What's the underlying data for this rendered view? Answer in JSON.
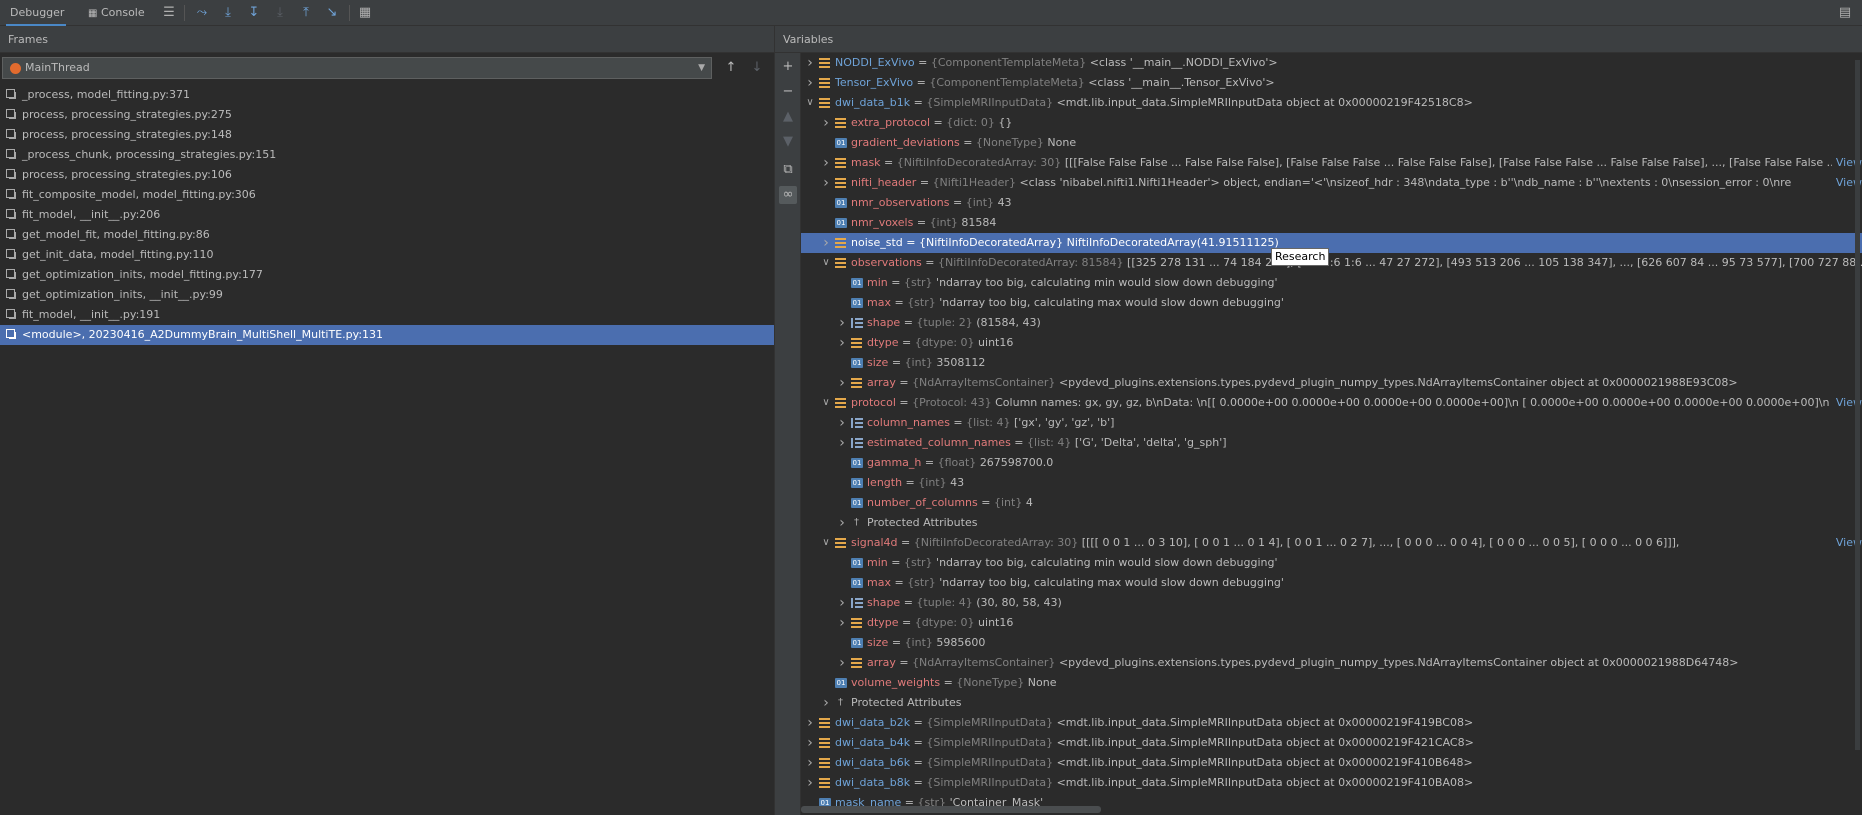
{
  "toolbar": {
    "debugger_tab": "Debugger",
    "console_tab": "Console",
    "buttons": [
      "menu-icon",
      "step-over-icon",
      "step-into-icon",
      "step-into-my-code-icon",
      "force-step-into-icon",
      "step-out-icon",
      "run-to-cursor-icon",
      "evaluate-table-icon"
    ]
  },
  "frames_panel": {
    "title": "Frames",
    "thread": "MainThread",
    "frames": [
      "_process, model_fitting.py:371",
      "process, processing_strategies.py:275",
      "process, processing_strategies.py:148",
      "_process_chunk, processing_strategies.py:151",
      "process, processing_strategies.py:106",
      "fit_composite_model, model_fitting.py:306",
      "fit_model, __init__.py:206",
      "get_model_fit, model_fitting.py:86",
      "get_init_data, model_fitting.py:110",
      "get_optimization_inits, model_fitting.py:177",
      "get_optimization_inits, __init__.py:99",
      "fit_model, __init__.py:191",
      "<module>, 20230416_A2DummyBrain_MultiShell_MultiTE.py:131"
    ],
    "selected_index": 12
  },
  "variables_panel": {
    "title": "Variables",
    "tooltip": "Research",
    "view_link": "View",
    "rows": [
      {
        "depth": 0,
        "arrow": "collapsed",
        "icon": "obj",
        "name": "NODDI_ExVivo",
        "style": "blue",
        "type": "{ComponentTemplateMeta}",
        "value": "<class '__main__.NODDI_ExVivo'>"
      },
      {
        "depth": 0,
        "arrow": "collapsed",
        "icon": "obj",
        "name": "Tensor_ExVivo",
        "style": "blue",
        "type": "{ComponentTemplateMeta}",
        "value": "<class '__main__.Tensor_ExVivo'>"
      },
      {
        "depth": 0,
        "arrow": "expanded",
        "icon": "obj",
        "name": "dwi_data_b1k",
        "style": "blue",
        "type": "{SimpleMRIInputData}",
        "value": "<mdt.lib.input_data.SimpleMRIInputData object at 0x00000219F42518C8>"
      },
      {
        "depth": 1,
        "arrow": "collapsed",
        "icon": "obj",
        "name": "extra_protocol",
        "style": "red",
        "type": "{dict: 0}",
        "value": "{}"
      },
      {
        "depth": 1,
        "arrow": "none",
        "icon": "01",
        "name": "gradient_deviations",
        "style": "red",
        "type": "{NoneType}",
        "value": "None"
      },
      {
        "depth": 1,
        "arrow": "collapsed",
        "icon": "obj",
        "name": "mask",
        "style": "red",
        "type": "{NiftiInfoDecoratedArray: 30}",
        "value": "[[[False False False ... False False False],  [False False False ... False False False],  [False False False ... False False False],  ...,  [False False False ... False Fal",
        "view": true
      },
      {
        "depth": 1,
        "arrow": "collapsed",
        "icon": "obj",
        "name": "nifti_header",
        "style": "red",
        "type": "{Nifti1Header}",
        "value": "<class 'nibabel.nifti1.Nifti1Header'> object, endian='<'\\nsizeof_hdr     : 348\\ndata_type      : b''\\ndb_name        : b''\\nextents        : 0\\nsession_error  : 0\\nre",
        "view": true
      },
      {
        "depth": 1,
        "arrow": "none",
        "icon": "01",
        "name": "nmr_observations",
        "style": "red",
        "type": "{int}",
        "value": "43"
      },
      {
        "depth": 1,
        "arrow": "none",
        "icon": "01",
        "name": "nmr_voxels",
        "style": "red",
        "type": "{int}",
        "value": "81584"
      },
      {
        "depth": 1,
        "arrow": "collapsed",
        "icon": "obj",
        "name": "noise_std",
        "style": "red",
        "type": "{NiftiInfoDecoratedArray}",
        "value": "NiftiInfoDecoratedArray(41.91511125)",
        "selected": true
      },
      {
        "depth": 1,
        "arrow": "expanded",
        "icon": "obj",
        "name": "observations",
        "style": "red",
        "type": "{NiftiInfoDecoratedArray: 81584}",
        "value": "[[325 278 131 ...  74 184 283], [2:6 2:6 1:6 ...  47  27 272], [493 513 206 ... 105 138 347], ..., [626 607  84 ...  95  73 577], [700 727  88 ...  88  48 685], [6",
        "view": false
      },
      {
        "depth": 2,
        "arrow": "none",
        "icon": "01",
        "name": "min",
        "style": "red",
        "type": "{str}",
        "value": "'ndarray too big, calculating min would slow down debugging'"
      },
      {
        "depth": 2,
        "arrow": "none",
        "icon": "01",
        "name": "max",
        "style": "red",
        "type": "{str}",
        "value": "'ndarray too big, calculating max would slow down debugging'"
      },
      {
        "depth": 2,
        "arrow": "collapsed",
        "icon": "list",
        "name": "shape",
        "style": "red",
        "type": "{tuple: 2}",
        "value": "(81584, 43)"
      },
      {
        "depth": 2,
        "arrow": "collapsed",
        "icon": "obj",
        "name": "dtype",
        "style": "red",
        "type": "{dtype: 0}",
        "value": "uint16"
      },
      {
        "depth": 2,
        "arrow": "none",
        "icon": "01",
        "name": "size",
        "style": "red",
        "type": "{int}",
        "value": "3508112"
      },
      {
        "depth": 2,
        "arrow": "collapsed",
        "icon": "obj",
        "name": "array",
        "style": "red",
        "type": "{NdArrayItemsContainer}",
        "value": "<pydevd_plugins.extensions.types.pydevd_plugin_numpy_types.NdArrayItemsContainer object at 0x0000021988E93C08>"
      },
      {
        "depth": 1,
        "arrow": "expanded",
        "icon": "obj",
        "name": "protocol",
        "style": "red",
        "type": "{Protocol: 43}",
        "value": "Column names: gx, gy, gz, b\\nData: \\n[[ 0.0000e+00  0.0000e+00  0.0000e+00  0.0000e+00]\\n [ 0.0000e+00  0.0000e+00  0.0000e+00  0.0000e+00]\\n [ 9.1906e-01 -...",
        "view": true
      },
      {
        "depth": 2,
        "arrow": "collapsed",
        "icon": "list",
        "name": "column_names",
        "style": "red",
        "type": "{list: 4}",
        "value": "['gx', 'gy', 'gz', 'b']"
      },
      {
        "depth": 2,
        "arrow": "collapsed",
        "icon": "list",
        "name": "estimated_column_names",
        "style": "red",
        "type": "{list: 4}",
        "value": "['G', 'Delta', 'delta', 'g_sph']"
      },
      {
        "depth": 2,
        "arrow": "none",
        "icon": "01",
        "name": "gamma_h",
        "style": "red",
        "type": "{float}",
        "value": "267598700.0"
      },
      {
        "depth": 2,
        "arrow": "none",
        "icon": "01",
        "name": "length",
        "style": "red",
        "type": "{int}",
        "value": "43"
      },
      {
        "depth": 2,
        "arrow": "none",
        "icon": "01",
        "name": "number_of_columns",
        "style": "red",
        "type": "{int}",
        "value": "4"
      },
      {
        "depth": 2,
        "arrow": "collapsed",
        "icon": "prot",
        "name": "Protected Attributes",
        "style": "plain",
        "type": "",
        "value": ""
      },
      {
        "depth": 1,
        "arrow": "expanded",
        "icon": "obj",
        "name": "signal4d",
        "style": "red",
        "type": "{NiftiInfoDecoratedArray: 30}",
        "value": "[[[[  0   0   1 ...   0   3  10],   [  0   0   1 ...   0   1   4],   [  0   0   1 ...   0   2   7],   ...,   [  0   0   0 ...   0   0   4],   [  0   0   0 ...   0   0   5],   [  0   0   0 ...   0   0   6]]],",
        "view": true
      },
      {
        "depth": 2,
        "arrow": "none",
        "icon": "01",
        "name": "min",
        "style": "red",
        "type": "{str}",
        "value": "'ndarray too big, calculating min would slow down debugging'"
      },
      {
        "depth": 2,
        "arrow": "none",
        "icon": "01",
        "name": "max",
        "style": "red",
        "type": "{str}",
        "value": "'ndarray too big, calculating max would slow down debugging'"
      },
      {
        "depth": 2,
        "arrow": "collapsed",
        "icon": "list",
        "name": "shape",
        "style": "red",
        "type": "{tuple: 4}",
        "value": "(30, 80, 58, 43)"
      },
      {
        "depth": 2,
        "arrow": "collapsed",
        "icon": "obj",
        "name": "dtype",
        "style": "red",
        "type": "{dtype: 0}",
        "value": "uint16"
      },
      {
        "depth": 2,
        "arrow": "none",
        "icon": "01",
        "name": "size",
        "style": "red",
        "type": "{int}",
        "value": "5985600"
      },
      {
        "depth": 2,
        "arrow": "collapsed",
        "icon": "obj",
        "name": "array",
        "style": "red",
        "type": "{NdArrayItemsContainer}",
        "value": "<pydevd_plugins.extensions.types.pydevd_plugin_numpy_types.NdArrayItemsContainer object at 0x0000021988D64748>"
      },
      {
        "depth": 1,
        "arrow": "none",
        "icon": "01",
        "name": "volume_weights",
        "style": "red",
        "type": "{NoneType}",
        "value": "None"
      },
      {
        "depth": 1,
        "arrow": "collapsed",
        "icon": "prot",
        "name": "Protected Attributes",
        "style": "plain",
        "type": "",
        "value": ""
      },
      {
        "depth": 0,
        "arrow": "collapsed",
        "icon": "obj",
        "name": "dwi_data_b2k",
        "style": "blue",
        "type": "{SimpleMRIInputData}",
        "value": "<mdt.lib.input_data.SimpleMRIInputData object at 0x00000219F419BC08>"
      },
      {
        "depth": 0,
        "arrow": "collapsed",
        "icon": "obj",
        "name": "dwi_data_b4k",
        "style": "blue",
        "type": "{SimpleMRIInputData}",
        "value": "<mdt.lib.input_data.SimpleMRIInputData object at 0x00000219F421CAC8>"
      },
      {
        "depth": 0,
        "arrow": "collapsed",
        "icon": "obj",
        "name": "dwi_data_b6k",
        "style": "blue",
        "type": "{SimpleMRIInputData}",
        "value": "<mdt.lib.input_data.SimpleMRIInputData object at 0x00000219F410B648>"
      },
      {
        "depth": 0,
        "arrow": "collapsed",
        "icon": "obj",
        "name": "dwi_data_b8k",
        "style": "blue",
        "type": "{SimpleMRIInputData}",
        "value": "<mdt.lib.input_data.SimpleMRIInputData object at 0x00000219F410BA08>"
      },
      {
        "depth": 0,
        "arrow": "none",
        "icon": "01",
        "name": "mask_name",
        "style": "blue",
        "type": "{str}",
        "value": "'Container_Mask'"
      }
    ]
  }
}
